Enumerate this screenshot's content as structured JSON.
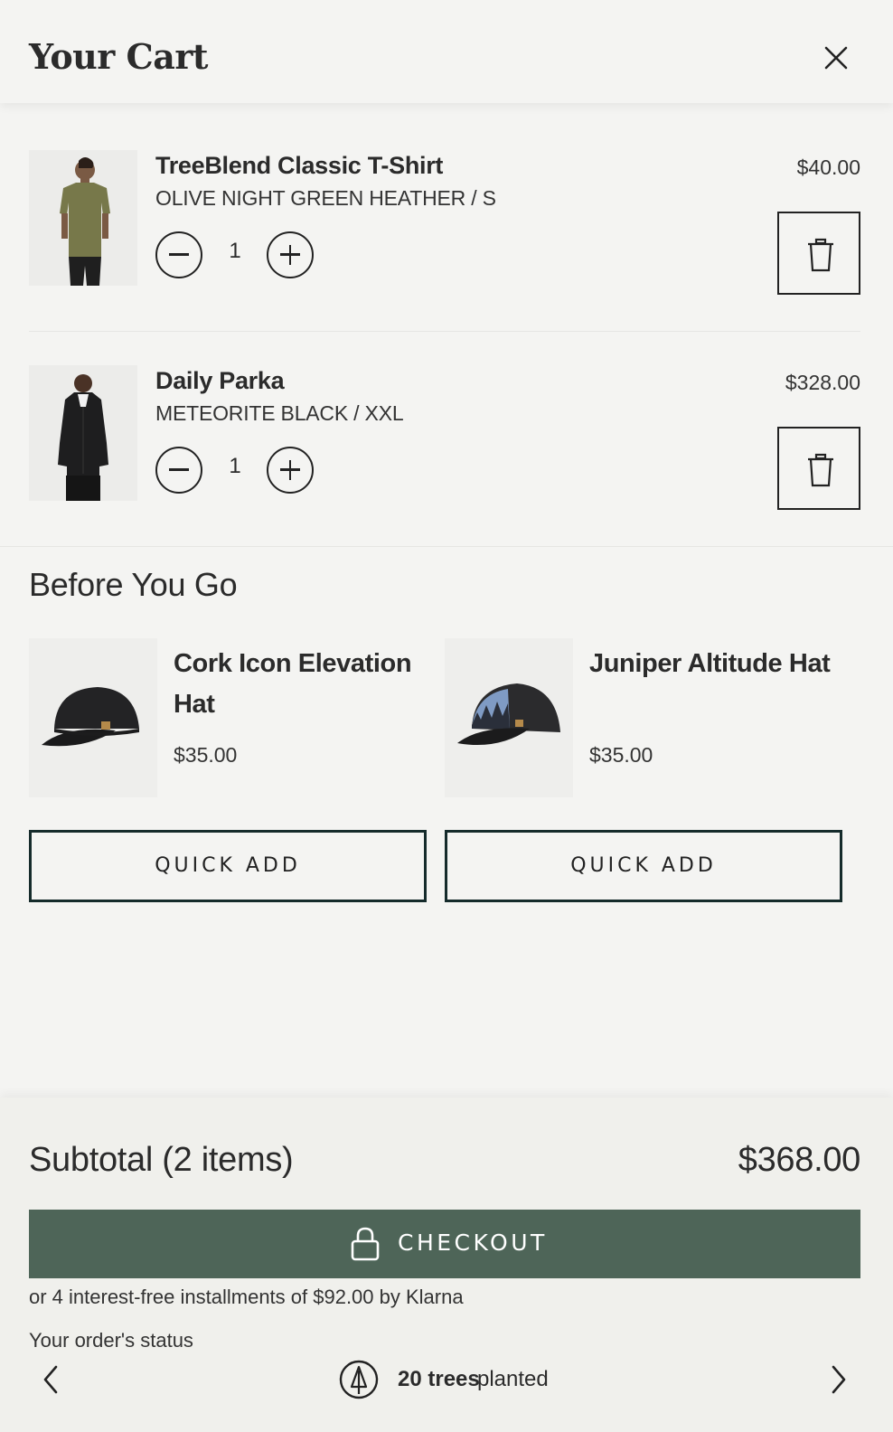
{
  "header": {
    "title": "Your Cart",
    "close_icon": "close-icon"
  },
  "cart_items": [
    {
      "name": "TreeBlend Classic T-Shirt",
      "variant": "OLIVE NIGHT GREEN HEATHER / S",
      "price": "$40.00",
      "quantity": "1",
      "image": "olive-t-shirt"
    },
    {
      "name": "Daily Parka",
      "variant": "METEORITE BLACK / XXL",
      "price": "$328.00",
      "quantity": "1",
      "image": "black-parka"
    }
  ],
  "recommendations": {
    "title": "Before You Go",
    "items": [
      {
        "name": "Cork Icon Elevation Hat",
        "price": "$35.00",
        "cta": "QUICK ADD",
        "image": "black-cap"
      },
      {
        "name": "Juniper Altitude Hat",
        "price": "$35.00",
        "cta": "QUICK ADD",
        "image": "trucker-hat"
      }
    ]
  },
  "footer": {
    "subtotal_label": "Subtotal (2 items)",
    "subtotal_value": "$368.00",
    "checkout_label": "CHECKOUT",
    "klarna_text": "or 4 interest-free installments of $92.00 by Klarna",
    "status_label": "Your order's status",
    "trees_count": "20 trees",
    "trees_suffix": "planted"
  },
  "colors": {
    "checkout": "#4e6558",
    "background": "#f4f4f2",
    "footer": "#f0f0ec",
    "button_border": "#152b2b"
  }
}
